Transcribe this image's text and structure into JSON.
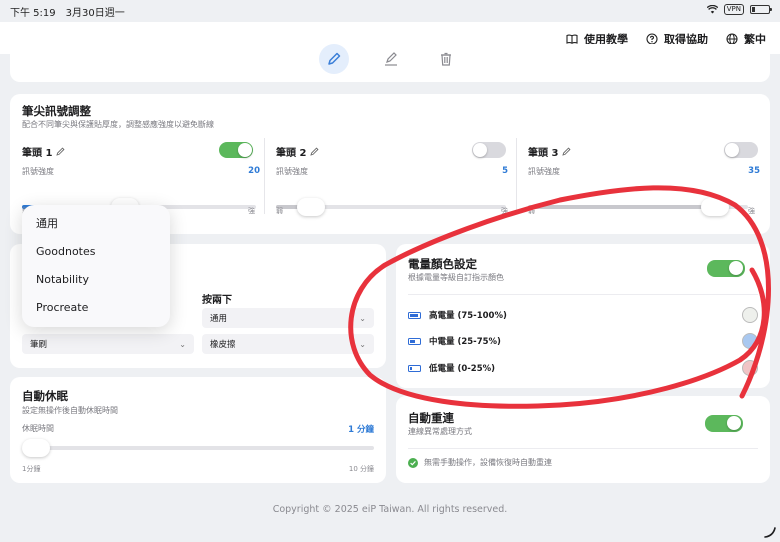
{
  "status_bar": {
    "time": "下午 5:19　3月30日週一",
    "vpn": "VPN"
  },
  "nav": {
    "tutorial": "使用教學",
    "help": "取得協助",
    "language": "繁中"
  },
  "tools": [
    "pen-icon",
    "highlighter-icon",
    "trash-icon"
  ],
  "pen_tips": {
    "title": "筆尖訊號調整",
    "subtitle": "配合不同筆尖與保護貼厚度，調整感應強度以避免斷線",
    "signal_label": "訊號強度",
    "min_label": "弱",
    "max_label": "強",
    "pens": [
      {
        "name": "筆頭 1",
        "enabled": true,
        "value": "20",
        "level": 0.44
      },
      {
        "name": "筆頭 2",
        "enabled": false,
        "value": "5",
        "level": 0.15
      },
      {
        "name": "筆頭 3",
        "enabled": false,
        "value": "35",
        "level": 0.85
      }
    ]
  },
  "buttons": {
    "press_two_label": "按兩下",
    "left_select": "筆刷",
    "right_select_1": "通用",
    "right_select_2": "橡皮擦"
  },
  "dropdown": {
    "items": [
      "通用",
      "Goodnotes",
      "Notability",
      "Procreate"
    ]
  },
  "sleep": {
    "title": "自動休眠",
    "subtitle": "設定無操作後自動休眠時間",
    "label": "休眠時間",
    "value": "1 分鐘",
    "min": "1分鐘",
    "max": "10 分鐘",
    "level": 0.0
  },
  "battery_color": {
    "title": "電量顏色設定",
    "subtitle": "根據電量等級自訂指示顏色",
    "enabled": true,
    "levels": [
      {
        "label": "高電量 (75-100%)",
        "color": "#eef0ec",
        "fill": 0.9
      },
      {
        "label": "中電量 (25-75%)",
        "color": "#a9c8f0",
        "fill": 0.5
      },
      {
        "label": "低電量 (0-25%)",
        "color": "#f0c4c6",
        "fill": 0.2
      }
    ]
  },
  "reconnect": {
    "title": "自動重連",
    "subtitle": "連線異常處理方式",
    "enabled": true,
    "note": "無需手動操作，設備恢復時自動重連"
  },
  "footer": "Copyright © 2025 eiP Taiwan. All rights reserved.",
  "colors": {
    "accent": "#2f7bd6",
    "toggle_on": "#5cb85c",
    "annotation": "#e8323c"
  }
}
